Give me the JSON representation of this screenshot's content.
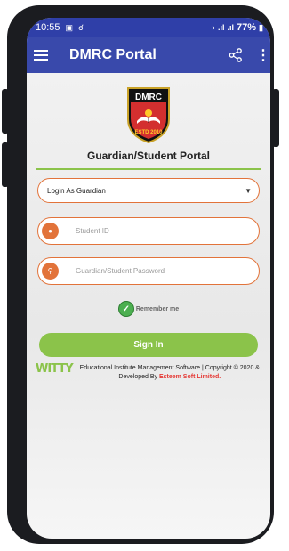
{
  "status_bar": {
    "time": "10:55",
    "left_icons": [
      "image-icon",
      "usb-icon"
    ],
    "battery": "77%"
  },
  "app_bar": {
    "title": "DMRC Portal"
  },
  "logo": {
    "top_text": "DMRC",
    "bottom_text": "ESTD 2010"
  },
  "portal_title": "Guardian/Student Portal",
  "login_type": {
    "selected": "Login As Guardian"
  },
  "student_id": {
    "placeholder": "Student ID"
  },
  "password": {
    "placeholder": "Guardian/Student Password"
  },
  "remember": {
    "label": "Remember me",
    "checked": true
  },
  "signin_label": "Sign In",
  "footer": {
    "brand": "WITTY",
    "text": "Educational Institute Management Software | Copyright © 2020 & Developed By ",
    "company": "Esteem Soft Limited."
  },
  "colors": {
    "primary": "#3949ab",
    "status_bar": "#2f3fa8",
    "accent_orange": "#e2733a",
    "green": "#8bc34a",
    "check_green": "#4caf50",
    "company_red": "#e53935"
  }
}
